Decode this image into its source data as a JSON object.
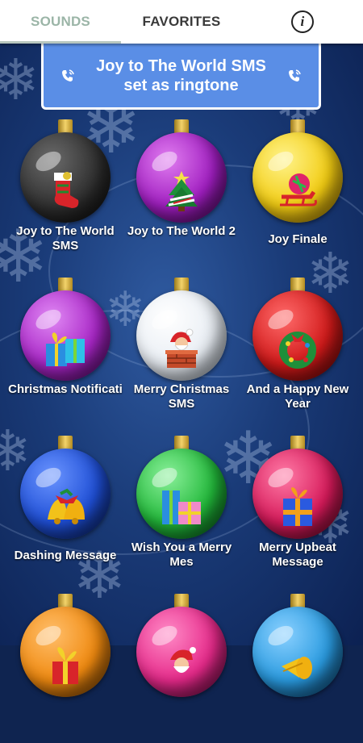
{
  "tabs": {
    "sounds": "SOUNDS",
    "favorites": "FAVORITES",
    "info_icon": "i"
  },
  "banner": {
    "line1": "Joy to The World SMS",
    "line2": "set as ringtone",
    "left_icon": "phone-ring-icon",
    "right_icon": "phone-ring-icon"
  },
  "sounds": [
    {
      "label": "Joy to The World SMS",
      "color": "#2b2b2b",
      "icon": "stocking-icon"
    },
    {
      "label": "Joy to The World 2",
      "color": "#a01ec0",
      "icon": "christmas-tree-icon"
    },
    {
      "label": "Joy Finale",
      "color": "#f2cc12",
      "icon": "sleigh-icon"
    },
    {
      "label": "Christmas Notificati",
      "color": "#a826c6",
      "icon": "gifts-icon"
    },
    {
      "label": "Merry Christmas SMS",
      "color": "#e9eef4",
      "icon": "santa-chimney-icon"
    },
    {
      "label": "And a Happy New Year",
      "color": "#d11a1a",
      "icon": "wreath-icon"
    },
    {
      "label": "Dashing Message",
      "color": "#1f4fd6",
      "icon": "bells-icon"
    },
    {
      "label": "Wish You a Merry Mes",
      "color": "#22b83a",
      "icon": "presents-icon"
    },
    {
      "label": "Merry Upbeat Message",
      "color": "#d61a5a",
      "icon": "gift-box-icon"
    },
    {
      "label": "",
      "color": "#f08a10",
      "icon": "gift-bow-icon"
    },
    {
      "label": "",
      "color": "#e62a8a",
      "icon": "santa-icon"
    },
    {
      "label": "",
      "color": "#2a9be0",
      "icon": "horn-icon"
    }
  ],
  "colors": {
    "accent_banner": "#5a8ee6",
    "tab_active": "#9bb5a7",
    "background": "#1a3b78"
  }
}
